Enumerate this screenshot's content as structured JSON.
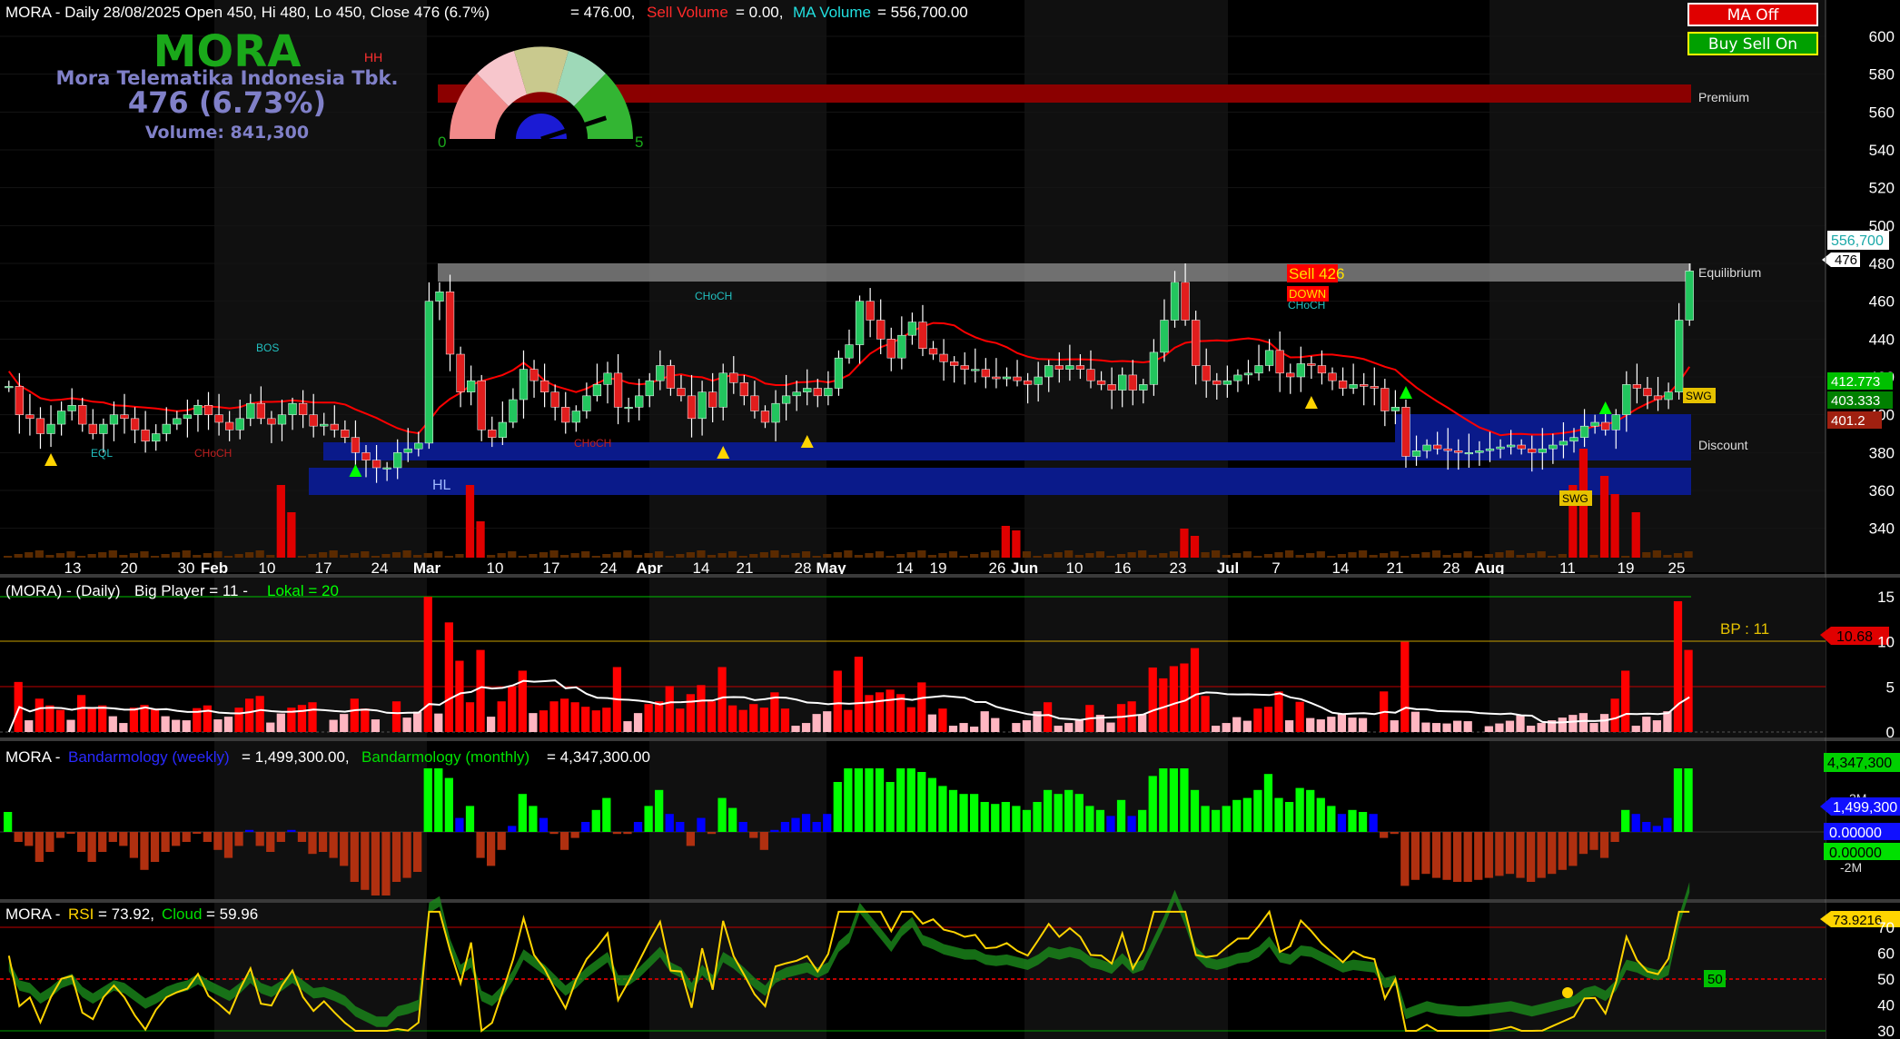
{
  "colors": {
    "background": "#000000",
    "bull": "#22c55e",
    "bear": "#e11d1d",
    "ma": "#ff0000",
    "rsi": "#ffd400",
    "bigplayer": "#ff0000",
    "lokal": "#ffb6c1",
    "band_weekly": "#0000ff",
    "band_monthly": "#00ff00",
    "zone_discount": "#0a1a8a",
    "zone_premium": "#8b0000",
    "zone_equilibrium": "#9a9a9a"
  },
  "header": {
    "symbol": "MORA",
    "title_line": "MORA - Daily 28/08/2025 Open 450, Hi 480, Lo 450, Close 476 (6.7%)",
    "price_eq": "= 476.00,",
    "sell_volume_label": "Sell Volume",
    "sell_volume_value": "= 0.00,",
    "ma_volume_label": "MA Volume",
    "ma_volume_value": "= 556,700.00"
  },
  "ticker_box": {
    "symbol": "MORA",
    "company": "Mora Telematika Indonesia Tbk.",
    "price": "476 (6.73%)",
    "volume": "Volume: 841,300"
  },
  "gauge": {
    "min_label": "0",
    "max_label": "5",
    "level_fraction": 0.9
  },
  "buttons": {
    "ma_off": "MA Off",
    "buy_sell_on": "Buy Sell On"
  },
  "price_chart": {
    "y_ticks": [
      "600",
      "580",
      "560",
      "540",
      "520",
      "500",
      "480",
      "460",
      "440",
      "420",
      "400",
      "380",
      "360",
      "340"
    ],
    "y_min": 320,
    "y_max": 600,
    "x_labels": [
      "13",
      "20",
      "30",
      "Feb",
      "10",
      "17",
      "24",
      "Mar",
      "10",
      "17",
      "24",
      "Apr",
      "14",
      "21",
      "28",
      "May",
      "14",
      "19",
      "26",
      "Jun",
      "10",
      "16",
      "23",
      "Jul",
      "7",
      "14",
      "21",
      "28",
      "Aug",
      "11",
      "19",
      "25"
    ],
    "month_labels": [
      "Feb",
      "Mar",
      "Apr",
      "May",
      "Jun",
      "Jul",
      "Aug"
    ],
    "zone_labels": {
      "premium": "Premium",
      "equilibrium": "Equilibrium",
      "discount": "Discount"
    },
    "annotations": {
      "hh": "HH",
      "bos": "BOS",
      "eql": "EQL",
      "choch": "CHoCH",
      "hl": "HL",
      "swg": "SWG",
      "sell": "Sell 426",
      "down": "DOWN"
    },
    "right_labels": {
      "ma_volume": "556,700",
      "close": "476",
      "l1": "412.773",
      "l2": "403.333",
      "l3": "401.2"
    }
  },
  "big_player": {
    "title_prefix": "(MORA) - (Daily)",
    "bp_label": "Big Player = 11 -",
    "lokal_label": "Lokal = 20",
    "bp_value": "BP : 11",
    "last_value": "10.68",
    "y_ticks": [
      "15",
      "10",
      "5",
      "0"
    ]
  },
  "bandarmology": {
    "prefix": "MORA -",
    "weekly_label": "Bandarmology (weekly)",
    "weekly_value": "= 1,499,300.00,",
    "monthly_label": "Bandarmology (monthly)",
    "monthly_value": "= 4,347,300.00",
    "right_values": [
      "4,347,300",
      "1,499,300",
      "0.00000",
      "0.00000"
    ],
    "y_ticks": [
      "2M",
      "-2M"
    ]
  },
  "rsi": {
    "prefix": "MORA -",
    "rsi_label": "RSI",
    "rsi_value": "= 73.92,",
    "cloud_label": "Cloud",
    "cloud_value": "= 59.96",
    "last_value": "73.9216",
    "fifty": "50",
    "y_ticks": [
      "70",
      "60",
      "50",
      "40",
      "30"
    ]
  },
  "chart_data": {
    "type": "candlestick",
    "start_label": "13",
    "end_label": "25",
    "closes": [
      415,
      400,
      398,
      390,
      395,
      402,
      405,
      395,
      390,
      395,
      400,
      398,
      392,
      386,
      390,
      395,
      398,
      400,
      405,
      400,
      396,
      392,
      398,
      406,
      398,
      395,
      400,
      406,
      400,
      394,
      395,
      392,
      388,
      380,
      376,
      372,
      372,
      380,
      382,
      385,
      460,
      465,
      432,
      412,
      418,
      392,
      388,
      396,
      408,
      424,
      418,
      412,
      404,
      396,
      402,
      410,
      416,
      422,
      404,
      404,
      410,
      418,
      426,
      414,
      410,
      398,
      412,
      404,
      422,
      417,
      410,
      402,
      396,
      406,
      410,
      412,
      414,
      410,
      414,
      430,
      437,
      460,
      450,
      440,
      430,
      442,
      449,
      435,
      432,
      428,
      426,
      424,
      424,
      420,
      419,
      420,
      418,
      416,
      420,
      426,
      424,
      426,
      424,
      418,
      416,
      413,
      421,
      413,
      416,
      433,
      450,
      470,
      450,
      426,
      418,
      416,
      418,
      421,
      422,
      426,
      434,
      422,
      420,
      427,
      426,
      422,
      418,
      414,
      416,
      415,
      414,
      402,
      404,
      378,
      381,
      384,
      382,
      381,
      380,
      380,
      381,
      382,
      383,
      384,
      382,
      380,
      382,
      384,
      386,
      388,
      394,
      396,
      392,
      400,
      416,
      414,
      410,
      408,
      412,
      450,
      476
    ],
    "ma_volume_last": 556700,
    "big_player_last": 10.68,
    "bandarmology_weekly": 1499300,
    "bandarmology_monthly": 4347300,
    "rsi_last": 73.92,
    "cloud_last": 59.96
  }
}
